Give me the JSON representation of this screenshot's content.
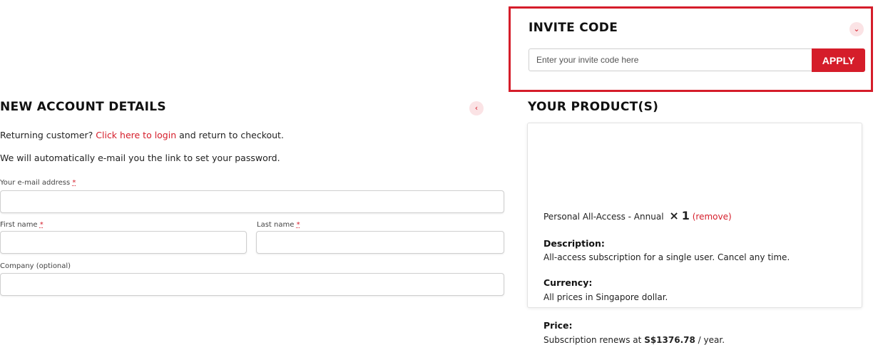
{
  "invite": {
    "title": "INVITE CODE",
    "toggle_icon": "chevron-down-icon",
    "placeholder": "Enter your invite code here",
    "value": "",
    "apply_label": "APPLY",
    "accent": "#d51d2a"
  },
  "account": {
    "title": "NEW ACCOUNT DETAILS",
    "toggle_icon": "chevron-left-icon",
    "returning_prefix": "Returning customer?",
    "login_link": "Click here to login",
    "returning_suffix": "and return to checkout.",
    "email_note": "We will automatically e-mail you the link to set your password.",
    "email_label": "Your e-mail address",
    "first_name_label": "First name",
    "last_name_label": "Last name",
    "company_label": "Company (optional)",
    "required_mark": "*"
  },
  "products": {
    "title": "YOUR PRODUCT(S)",
    "item_name": "Personal All-Access - Annual",
    "qty_mark": "×",
    "qty": "1",
    "remove_label": "(remove)",
    "description_title": "Description:",
    "description": "All-access subscription for a single user. Cancel any time.",
    "currency_title": "Currency:",
    "currency": "All prices in Singapore dollar.",
    "price_title": "Price:",
    "price_prefix": "Subscription renews at",
    "price_value": "S$1376.78",
    "price_suffix": "/ year."
  }
}
